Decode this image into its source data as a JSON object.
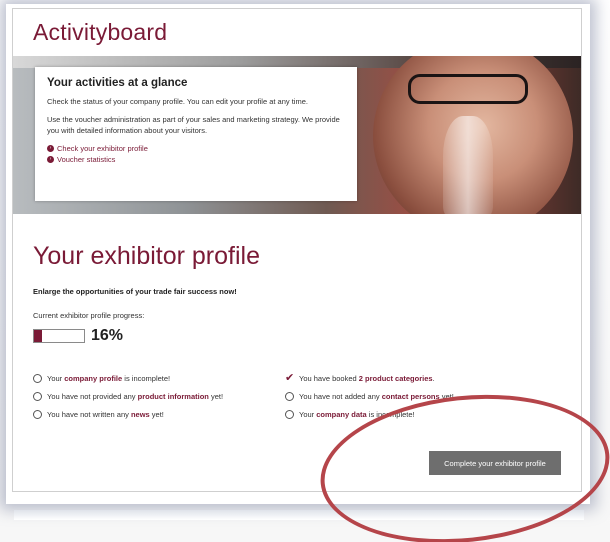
{
  "page": {
    "title": "Activityboard"
  },
  "hero_card": {
    "heading": "Your activities at a glance",
    "para1": "Check the status of your company profile. You can edit your profile at any time.",
    "para2": "Use the voucher administration as part of your sales and marketing strategy. We provide you with detailed information about your visitors.",
    "links": [
      "Check your exhibitor profile",
      "Voucher statistics"
    ]
  },
  "profile": {
    "title": "Your exhibitor profile",
    "subtitle": "Enlarge the opportunities of your trade fair success now!",
    "progress_label": "Current exhibitor profile progress:",
    "progress_value": 0.16,
    "progress_text": "16%",
    "left_items": [
      {
        "pre": "Your ",
        "hl": "company profile",
        "post": " is incomplete!"
      },
      {
        "pre": "You have not provided any ",
        "hl": "product information",
        "post": " yet!"
      },
      {
        "pre": "You have not written any ",
        "hl": "news",
        "post": " yet!"
      }
    ],
    "right_items": [
      {
        "pre": "You have booked ",
        "hl": "2 product categories",
        "post": "."
      },
      {
        "pre": "You have not added any ",
        "hl": "contact persons",
        "post": " yet!"
      },
      {
        "pre": "Your ",
        "hl": "company data",
        "post": " is incomplete!"
      }
    ],
    "cta_label": "Complete your exhibitor profile"
  },
  "colors": {
    "accent": "#7a1a36",
    "annotation_ring": "#b5454a",
    "button": "#6e6e6e"
  },
  "icons": {
    "link_bullet": "arrow-circle-icon",
    "status_incomplete": "empty-circle-icon",
    "status_done": "check-icon"
  }
}
